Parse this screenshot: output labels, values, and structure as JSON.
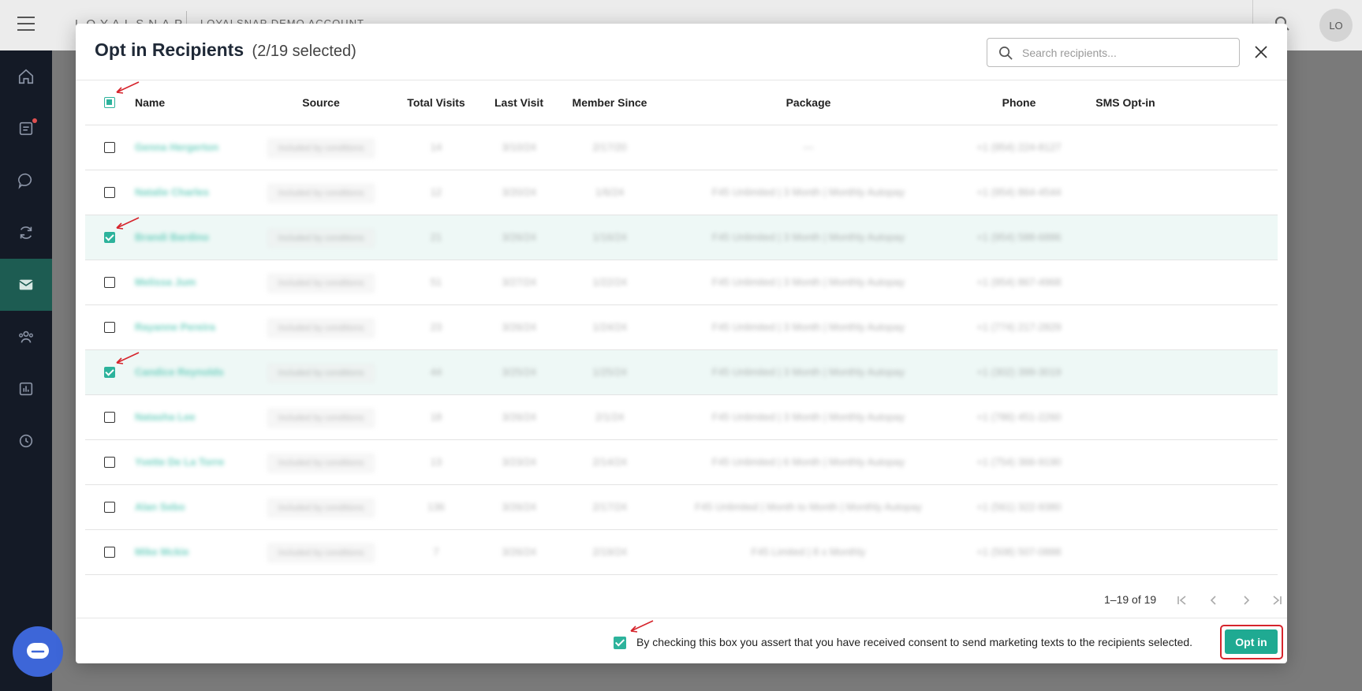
{
  "app": {
    "brand": "LOYALSNAP",
    "account": "LOYALSNAP DEMO ACCOUNT",
    "avatar_initials": "LO"
  },
  "sidebar": {
    "items": [
      {
        "icon": "home-icon"
      },
      {
        "icon": "tasks-icon",
        "has_badge": true
      },
      {
        "icon": "chat-icon"
      },
      {
        "icon": "refresh-icon"
      },
      {
        "icon": "mail-icon",
        "active": true
      },
      {
        "icon": "people-icon"
      },
      {
        "icon": "chart-icon"
      },
      {
        "icon": "history-icon"
      }
    ]
  },
  "modal": {
    "title": "Opt in Recipients",
    "count": "(2/19 selected)",
    "search_placeholder": "Search recipients...",
    "columns": [
      "Name",
      "Source",
      "Total Visits",
      "Last Visit",
      "Member Since",
      "Package",
      "Phone",
      "SMS Opt-in"
    ],
    "rows": [
      {
        "name": "Genna Hergerton",
        "source": "Included by conditions",
        "visits": "14",
        "last": "3/10/24",
        "since": "2/17/20",
        "package": "—",
        "phone": "+1 (954) 224-8127",
        "checked": false
      },
      {
        "name": "Natalie Charles",
        "source": "Included by conditions",
        "visits": "12",
        "last": "3/20/24",
        "since": "1/6/24",
        "package": "F45 Unlimited | 3 Month | Monthly Autopay",
        "phone": "+1 (954) 864-4544",
        "checked": false
      },
      {
        "name": "Brandi Bardino",
        "source": "Included by conditions",
        "visits": "21",
        "last": "3/26/24",
        "since": "1/16/24",
        "package": "F45 Unlimited | 3 Month | Monthly Autopay",
        "phone": "+1 (954) 588-6886",
        "checked": true
      },
      {
        "name": "Melissa Jum",
        "source": "Included by conditions",
        "visits": "51",
        "last": "3/27/24",
        "since": "1/22/24",
        "package": "F45 Unlimited | 3 Month | Monthly Autopay",
        "phone": "+1 (954) 867-4968",
        "checked": false
      },
      {
        "name": "Rayanne Pereira",
        "source": "Included by conditions",
        "visits": "23",
        "last": "3/26/24",
        "since": "1/24/24",
        "package": "F45 Unlimited | 3 Month | Monthly Autopay",
        "phone": "+1 (774) 217-2829",
        "checked": false
      },
      {
        "name": "Candice Reynolds",
        "source": "Included by conditions",
        "visits": "44",
        "last": "3/25/24",
        "since": "1/25/24",
        "package": "F45 Unlimited | 3 Month | Monthly Autopay",
        "phone": "+1 (302) 399-3019",
        "checked": true
      },
      {
        "name": "Natasha Lee",
        "source": "Included by conditions",
        "visits": "18",
        "last": "3/26/24",
        "since": "2/1/24",
        "package": "F45 Unlimited | 3 Month | Monthly Autopay",
        "phone": "+1 (786) 451-2260",
        "checked": false
      },
      {
        "name": "Yvette De La Torre",
        "source": "Included by conditions",
        "visits": "13",
        "last": "3/23/24",
        "since": "2/14/24",
        "package": "F45 Unlimited | 6 Month | Monthly Autopay",
        "phone": "+1 (754) 366-9190",
        "checked": false
      },
      {
        "name": "Alan Sebo",
        "source": "Included by conditions",
        "visits": "136",
        "last": "3/26/24",
        "since": "2/17/24",
        "package": "F45 Unlimited | Month to Month | Monthly Autopay",
        "phone": "+1 (561) 322-9380",
        "checked": false
      },
      {
        "name": "Mike Mckie",
        "source": "Included by conditions",
        "visits": "7",
        "last": "3/26/24",
        "since": "2/19/24",
        "package": "F45 Limited | 8 x Monthly",
        "phone": "+1 (508) 507-0888",
        "checked": false
      }
    ],
    "pagination": "1–19 of 19",
    "consent_text": "By checking this box you assert that you have received consent to send marketing texts to the recipients selected.",
    "consent_checked": true,
    "optin_label": "Opt in"
  },
  "colors": {
    "accent": "#2db39c",
    "highlight": "#d6242c",
    "sidebar": "#141a26"
  }
}
